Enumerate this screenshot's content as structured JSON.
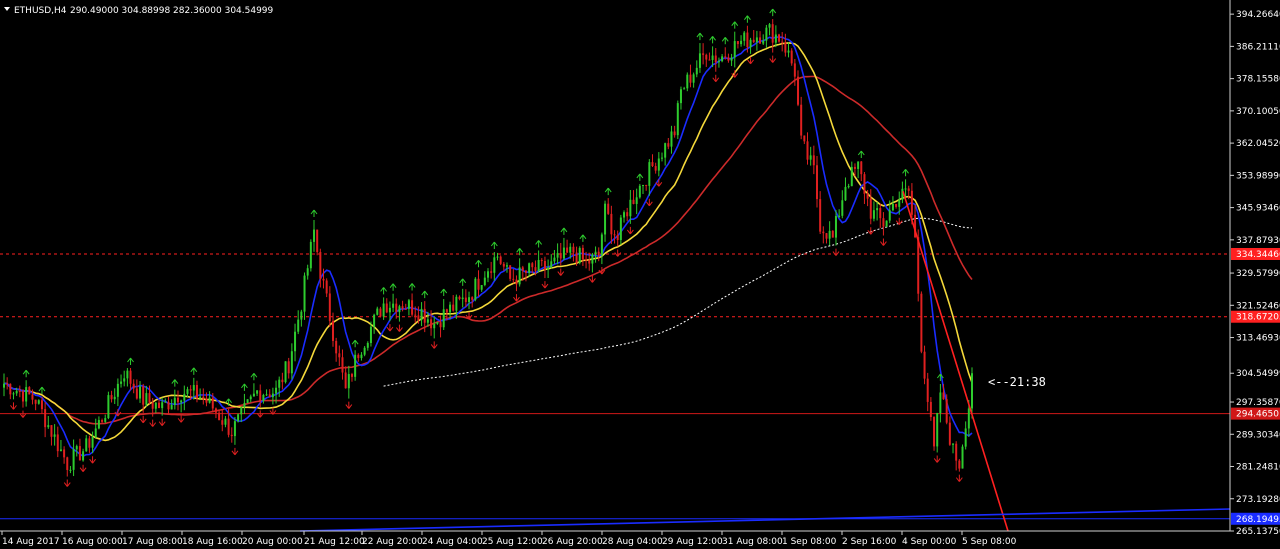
{
  "chart_data": {
    "type": "candlestick",
    "symbol": "ETHUSD,H4",
    "ohlc_readout": "290.49000 304.88998 282.36000 304.54999",
    "countdown": "<--21:38",
    "ylim": [
      265.1375,
      397.8
    ],
    "y_ticks": [
      "394.26640",
      "386.21110",
      "378.15580",
      "370.10050",
      "362.04520",
      "353.98990",
      "345.93460",
      "337.87930",
      "329.57990",
      "321.52460",
      "313.46930",
      "304.54999",
      "297.35870",
      "289.30340",
      "281.24810",
      "273.19280",
      "265.13750"
    ],
    "x_ticks": [
      "14 Aug 2017",
      "16 Aug 00:00",
      "17 Aug 08:00",
      "18 Aug 16:00",
      "20 Aug 00:00",
      "21 Aug 12:00",
      "22 Aug 20:00",
      "24 Aug 04:00",
      "25 Aug 12:00",
      "26 Aug 20:00",
      "28 Aug 04:00",
      "29 Aug 12:00",
      "31 Aug 08:00",
      "1 Sep 08:00",
      "2 Sep 16:00",
      "4 Sep 00:00",
      "5 Sep 08:00"
    ],
    "levels": [
      {
        "label": "334.34466",
        "value": 334.34466,
        "color": "#ff2020",
        "style": "dashed"
      },
      {
        "label": "318.67205",
        "value": 318.67205,
        "color": "#ff2020",
        "style": "dashed"
      },
      {
        "label": "294.46501",
        "value": 294.46501,
        "color": "#d01818",
        "style": "solid"
      },
      {
        "label": "268.19495",
        "value": 268.19495,
        "color": "#1a2cff",
        "style": "solid"
      }
    ],
    "colors": {
      "background": "#000000",
      "bull": "#2ecc2e",
      "bear": "#e02020",
      "ma_fast": "#1a2cff",
      "ma_mid": "#f4d83a",
      "ma_slow": "#cc2a2a",
      "ma_long": "#ffffff",
      "trendline_red": "#ff2020",
      "trendline_blue": "#1a2cff",
      "axis_text": "#ffffff"
    }
  }
}
